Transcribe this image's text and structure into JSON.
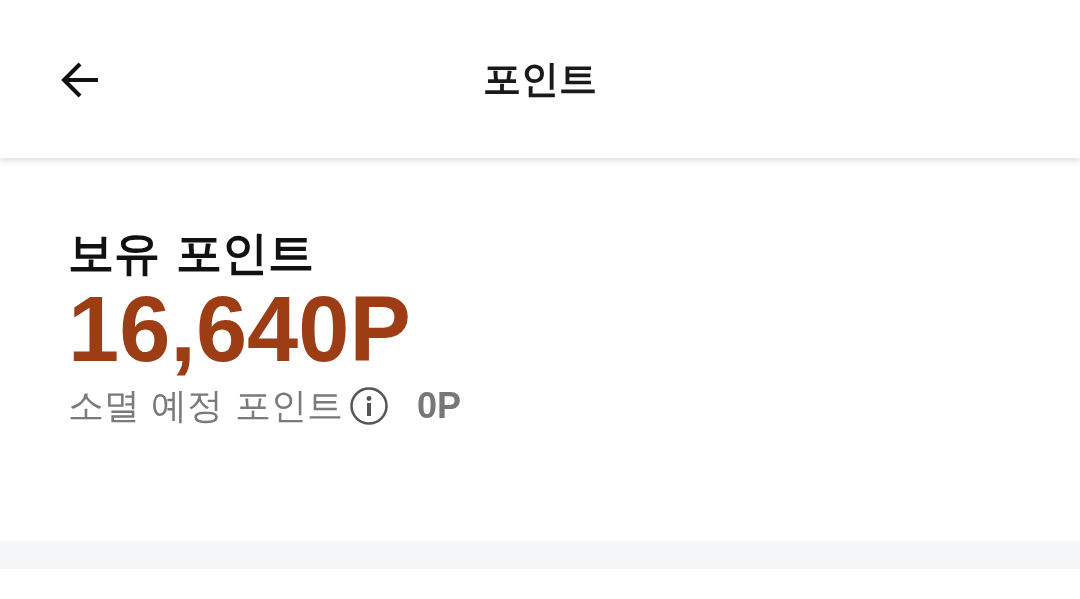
{
  "header": {
    "title": "포인트"
  },
  "balance": {
    "label": "보유 포인트",
    "amount": "16,640P"
  },
  "expiring": {
    "label": "소멸 예정 포인트",
    "amount": "0P"
  }
}
